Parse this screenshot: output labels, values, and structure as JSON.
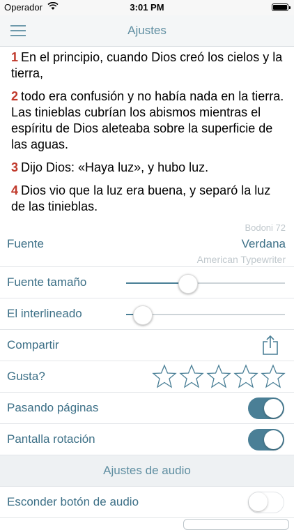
{
  "status_bar": {
    "carrier": "Operador",
    "time": "3:01 PM"
  },
  "navbar": {
    "title": "Ajustes"
  },
  "scripture": [
    {
      "num": "1",
      "text": "En el principio, cuando Dios creó los cielos y la tierra,"
    },
    {
      "num": "2",
      "text": "todo era confusión y no había nada en la tierra. Las tinieblas cubrían los abismos mientras el espíritu de Dios aleteaba sobre la superficie de las aguas."
    },
    {
      "num": "3",
      "text": "Dijo Dios: «Haya luz», y hubo luz."
    },
    {
      "num": "4",
      "text": "Dios vio que la luz era buena, y separó la luz de las tinieblas."
    }
  ],
  "settings": {
    "font": {
      "label": "Fuente",
      "prev_option": "Bodoni 72",
      "selected": "Verdana",
      "next_option": "American Typewriter"
    },
    "font_size": {
      "label": "Fuente tamaño",
      "value": 0.37
    },
    "line_spacing": {
      "label": "El interlineado",
      "value": 0.05
    },
    "share": {
      "label": "Compartir",
      "icon": "share-icon"
    },
    "rating": {
      "label": "Gusta?",
      "stars": 0,
      "max": 5
    },
    "page_turn": {
      "label": "Pasando páginas",
      "on": true
    },
    "rotation": {
      "label": "Pantalla rotación",
      "on": true
    },
    "audio_section": {
      "title": "Ajustes de audio"
    },
    "hide_audio": {
      "label": "Esconder botón de audio",
      "on": false
    }
  },
  "colors": {
    "accent": "#4a7f96",
    "verse_number": "#c0392b",
    "label": "#3d7087"
  }
}
